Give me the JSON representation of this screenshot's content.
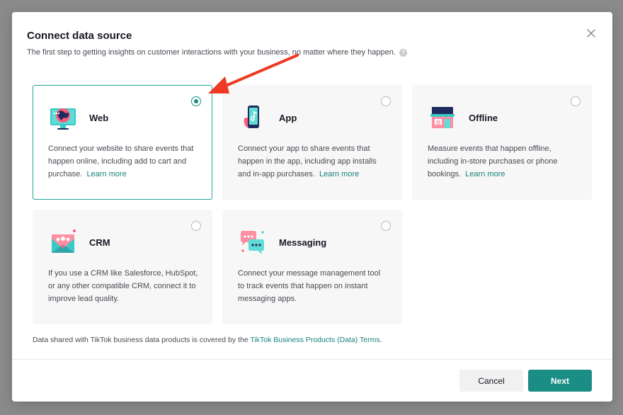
{
  "dialog": {
    "title": "Connect data source",
    "subtitle": "The first step to getting insights on customer interactions with your business, no matter where they happen.",
    "help_icon": "?"
  },
  "sources": [
    {
      "name": "Web",
      "icon": "web-icon",
      "selected": true,
      "desc": "Connect your website to share events that happen online, including add to cart and purchase.",
      "link": "Learn more"
    },
    {
      "name": "App",
      "icon": "app-icon",
      "selected": false,
      "desc": "Connect your app to share events that happen in the app, including app installs and in-app purchases.",
      "link": "Learn more"
    },
    {
      "name": "Offline",
      "icon": "store-icon",
      "selected": false,
      "desc": "Measure events that happen offline, including in-store purchases or phone bookings.",
      "link": "Learn more"
    },
    {
      "name": "CRM",
      "icon": "crm-icon",
      "selected": false,
      "desc": "If you use a CRM like Salesforce, HubSpot, or any other compatible CRM, connect it to improve lead quality."
    },
    {
      "name": "Messaging",
      "icon": "chat-icon",
      "selected": false,
      "desc": "Connect your message management tool to track events that happen on instant messaging apps."
    }
  ],
  "terms": {
    "prefix": "Data shared with TikTok business data products is covered by the ",
    "link": "TikTok Business Products (Data) Terms",
    "suffix": "."
  },
  "buttons": {
    "cancel": "Cancel",
    "next": "Next"
  },
  "colors": {
    "accent": "#1a8d85",
    "annotation_arrow": "#ee3a24"
  }
}
